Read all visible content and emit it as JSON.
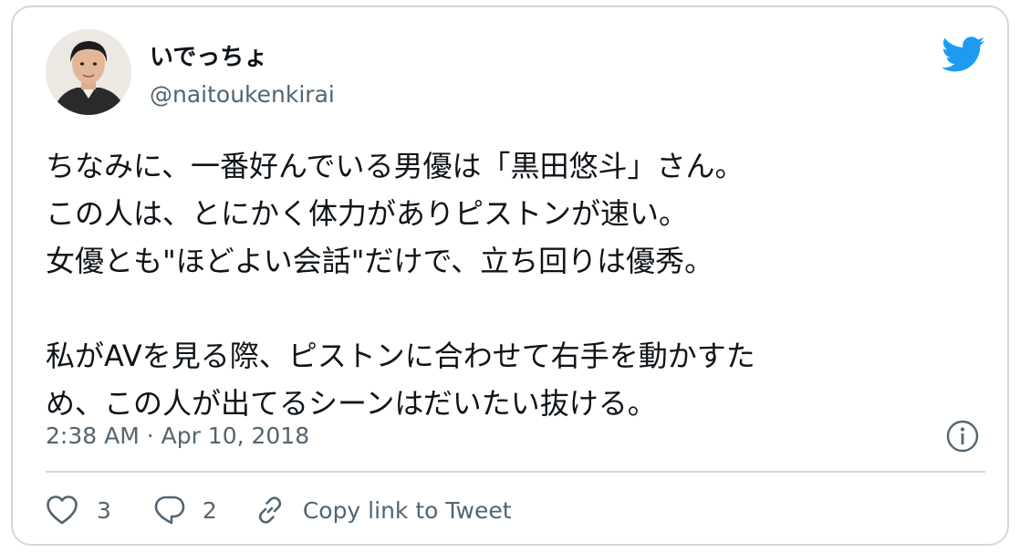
{
  "author": {
    "display_name": "いでっちょ",
    "handle": "@naitoukenkirai",
    "avatar": "avatar"
  },
  "brand": {
    "logo_icon": "twitter-bird-icon",
    "color": "#1d9bf0"
  },
  "tweet": {
    "lines": [
      "ちなみに、一番好んでいる男優は「黒田悠斗」さん。",
      "この人は、とにかく体力がありピストンが速い。",
      "女優とも\"ほどよい会話\"だけで、立ち回りは優秀。",
      "",
      "私がAVを見る際、ピストンに合わせて右手を動かすた",
      "め、この人が出てるシーンはだいたい抜ける。"
    ],
    "timestamp": "2:38 AM · Apr 10, 2018"
  },
  "actions": {
    "like_count": "3",
    "reply_count": "2",
    "copy_link_label": "Copy link to Tweet"
  },
  "icons": {
    "info": "info-icon",
    "like": "heart-icon",
    "reply": "reply-icon",
    "link": "link-icon"
  },
  "colors": {
    "text": "#0f1419",
    "secondary": "#536471",
    "border": "#cfd9de"
  }
}
